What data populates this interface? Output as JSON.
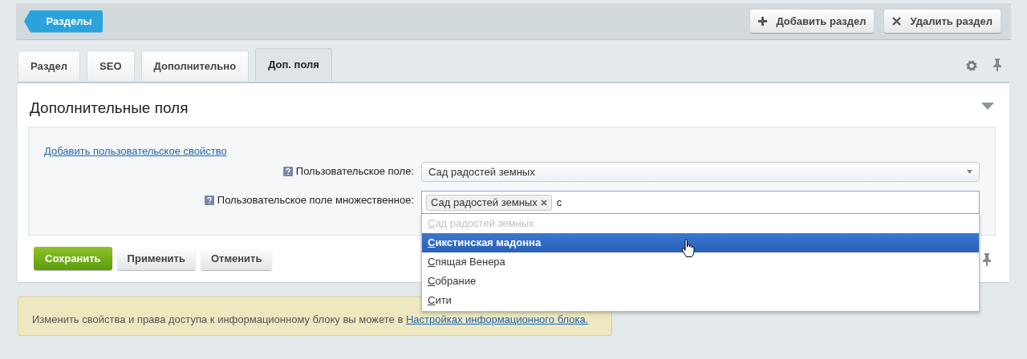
{
  "toolbar": {
    "back_button": "Разделы",
    "buttons": [
      {
        "kind": "add",
        "label": "Добавить раздел"
      },
      {
        "kind": "delete",
        "label": "Удалить раздел"
      }
    ]
  },
  "tabs": [
    {
      "label": "Раздел",
      "selected": false
    },
    {
      "label": "SEO",
      "selected": false
    },
    {
      "label": "Дополнительно",
      "selected": false
    },
    {
      "label": "Доп. поля",
      "selected": true
    }
  ],
  "section": {
    "title": "Дополнительные поля",
    "expanded": true,
    "add_link": "Добавить пользовательское свойство",
    "fields": [
      {
        "kind": "select",
        "label": "Пользовательское поле:",
        "value": "Сад радостей земных"
      },
      {
        "kind": "multiselect",
        "label": "Пользовательское поле множественное:",
        "tags": [
          "Сад радостей земных"
        ],
        "value": "с",
        "options": [
          {
            "match": "С",
            "rest": "ад радостей земных",
            "disabled": true,
            "selected": false
          },
          {
            "match": "С",
            "rest": "икстинская мадонна",
            "disabled": false,
            "selected": true
          },
          {
            "match": "С",
            "rest": "пящая Венера",
            "disabled": false,
            "selected": false
          },
          {
            "match": "С",
            "rest": "обрание",
            "disabled": false,
            "selected": false
          },
          {
            "match": "С",
            "rest": "ити",
            "disabled": false,
            "selected": false
          }
        ]
      }
    ]
  },
  "actions": [
    {
      "kind": "primary",
      "label": "Сохранить"
    },
    {
      "kind": "secondary",
      "label": "Применить"
    },
    {
      "kind": "secondary",
      "label": "Отменить"
    }
  ],
  "notice": {
    "text": "Изменить свойства и права доступа к информационному блоку вы можете в",
    "link": "Настройках информационного блока."
  }
}
